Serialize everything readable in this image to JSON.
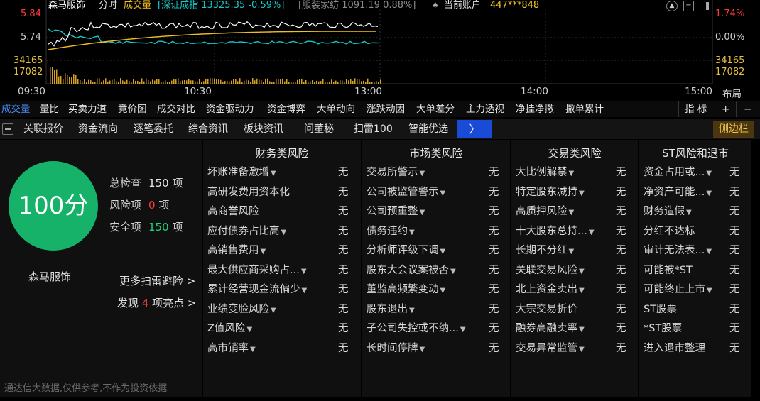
{
  "header": {
    "stock_name": "森马服饰",
    "view_mode": "分时",
    "indicator": "成交量",
    "index_info": "[深证成指 13325.35 -0.59%]",
    "sector_info": "[服装家纺 1091.19 0.88%]",
    "account_label": "当前账户",
    "account_value": "447***848"
  },
  "chart": {
    "price_high": "5.84",
    "price_mid": "5.74",
    "pct_high": "1.74%",
    "pct_mid": "0.00%",
    "vol_high": "34165",
    "vol_mid": "17082",
    "times": [
      "09:30",
      "10:30",
      "13:00",
      "14:00",
      "15:00"
    ],
    "layout_label": "布局",
    "colors": {
      "price": "#ffffff",
      "avg": "#f0c020",
      "cyan": "#19c6c6",
      "volume": "#d8a020",
      "grid": "#333333"
    }
  },
  "tabs1": {
    "items": [
      "成交量",
      "量比",
      "买卖力道",
      "竞价图",
      "成交对比",
      "资金驱动力",
      "资金博弈",
      "大单动向",
      "涨跌动因",
      "大单差分",
      "主力透视",
      "净挂净撤",
      "撤单累计"
    ],
    "active_index": 0,
    "indicator_label": "指 标",
    "plus": "+",
    "minus": "−"
  },
  "tabs2": {
    "items": [
      "关联报价",
      "资金流向",
      "逐笔委托",
      "综合资讯",
      "板块资讯",
      "问董秘",
      "扫雷100",
      "智能优选"
    ],
    "more": "〉",
    "sidebar": "侧边栏"
  },
  "summary": {
    "score": "100分",
    "total_label": "总检查",
    "total_value": "150",
    "risk_label": "风险项",
    "risk_value": "0",
    "safe_label": "安全项",
    "safe_value": "150",
    "unit": "项",
    "stock_name": "森马服饰",
    "more_link": "更多扫雷避险 >",
    "find_prefix": "发现",
    "find_count": "4",
    "find_suffix": "项亮点 >",
    "footnote": "通达信大数据,仅供参考,不作为投资依据"
  },
  "columns": [
    {
      "title": "财务类风险",
      "rows": [
        {
          "name": "坏账准备激增",
          "dropdown": true,
          "result": "无"
        },
        {
          "name": "高研发费用资本化",
          "dropdown": false,
          "result": "无"
        },
        {
          "name": "高商誉风险",
          "dropdown": false,
          "result": "无"
        },
        {
          "name": "应付债券占比高",
          "dropdown": true,
          "result": "无"
        },
        {
          "name": "高销售费用",
          "dropdown": true,
          "result": "无"
        },
        {
          "name": "最大供应商采购占...",
          "dropdown": true,
          "result": "无"
        },
        {
          "name": "累计经营现金流偏少",
          "dropdown": true,
          "result": "无"
        },
        {
          "name": "业绩变脸风险",
          "dropdown": true,
          "result": "无"
        },
        {
          "name": "Z值风险",
          "dropdown": true,
          "result": "无"
        },
        {
          "name": "高市销率",
          "dropdown": true,
          "result": "无"
        }
      ]
    },
    {
      "title": "市场类风险",
      "rows": [
        {
          "name": "交易所警示",
          "dropdown": true,
          "result": "无"
        },
        {
          "name": "公司被监管警示",
          "dropdown": true,
          "result": "无"
        },
        {
          "name": "公司预重整",
          "dropdown": true,
          "result": "无"
        },
        {
          "name": "债务违约",
          "dropdown": true,
          "result": "无"
        },
        {
          "name": "分析师评级下调",
          "dropdown": true,
          "result": "无"
        },
        {
          "name": "股东大会议案被否",
          "dropdown": true,
          "result": "无"
        },
        {
          "name": "董监高频繁变动",
          "dropdown": true,
          "result": "无"
        },
        {
          "name": "股东退出",
          "dropdown": true,
          "result": "无"
        },
        {
          "name": "子公司失控或不纳...",
          "dropdown": true,
          "result": "无"
        },
        {
          "name": "长时间停牌",
          "dropdown": true,
          "result": "无"
        }
      ]
    },
    {
      "title": "交易类风险",
      "rows": [
        {
          "name": "大比例解禁",
          "dropdown": true,
          "result": "无"
        },
        {
          "name": "特定股东减持",
          "dropdown": true,
          "result": "无"
        },
        {
          "name": "高质押风险",
          "dropdown": true,
          "result": "无"
        },
        {
          "name": "十大股东总持...",
          "dropdown": true,
          "result": "无"
        },
        {
          "name": "长期不分红",
          "dropdown": true,
          "result": "无"
        },
        {
          "name": "关联交易风险",
          "dropdown": true,
          "result": "无"
        },
        {
          "name": "北上资金卖出",
          "dropdown": true,
          "result": "无"
        },
        {
          "name": "大宗交易折价",
          "dropdown": false,
          "result": "无"
        },
        {
          "name": "融券高融卖率",
          "dropdown": true,
          "result": "无"
        },
        {
          "name": "交易异常监管",
          "dropdown": true,
          "result": "无"
        }
      ]
    },
    {
      "title": "ST风险和退市",
      "rows": [
        {
          "name": "资金占用或...",
          "dropdown": true,
          "result": "无"
        },
        {
          "name": "净资产可能...",
          "dropdown": true,
          "result": "无"
        },
        {
          "name": "财务造假",
          "dropdown": true,
          "result": "无"
        },
        {
          "name": "分红不达标",
          "dropdown": false,
          "result": "无"
        },
        {
          "name": "审计无法表...",
          "dropdown": true,
          "result": "无"
        },
        {
          "name": "可能被*ST",
          "dropdown": false,
          "result": "无"
        },
        {
          "name": "可能终止上市",
          "dropdown": true,
          "result": "无"
        },
        {
          "name": "ST股票",
          "dropdown": false,
          "result": "无"
        },
        {
          "name": "*ST股票",
          "dropdown": false,
          "result": "无"
        },
        {
          "name": "进入退市整理",
          "dropdown": false,
          "result": "无"
        }
      ]
    }
  ]
}
